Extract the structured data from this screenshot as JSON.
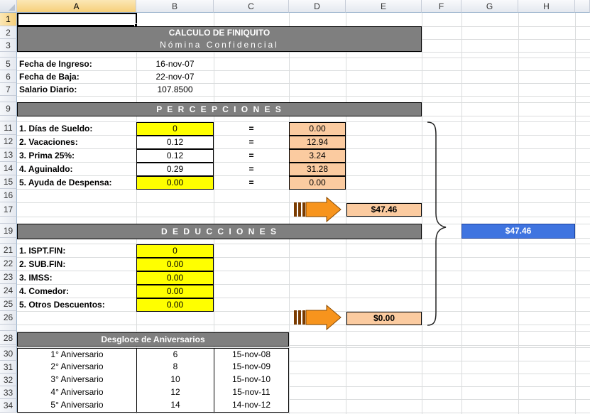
{
  "columns": [
    "A",
    "B",
    "C",
    "D",
    "E",
    "F",
    "G",
    "H"
  ],
  "rows": [
    "1",
    "2",
    "3",
    "",
    "5",
    "6",
    "7",
    "",
    "9",
    "",
    "11",
    "12",
    "13",
    "14",
    "15",
    "16",
    "17",
    "",
    "19",
    "",
    "21",
    "22",
    "23",
    "24",
    "25",
    "26",
    "",
    "28",
    "",
    "30",
    "31",
    "32",
    "33",
    "34"
  ],
  "title": {
    "main": "CALCULO DE FINIQUITO",
    "sub": "Nómina Confidencial"
  },
  "info": [
    {
      "label": "Fecha de Ingreso:",
      "value": "16-nov-07"
    },
    {
      "label": "Fecha de Baja:",
      "value": "22-nov-07"
    },
    {
      "label": "Salario Diario:",
      "value": "107.8500"
    }
  ],
  "percepciones": {
    "header": "P E R C E P C I O N E S",
    "items": [
      {
        "label": "1. Días de Sueldo:",
        "input": "0",
        "eq": "=",
        "result": "0.00"
      },
      {
        "label": "2. Vacaciones:",
        "input": "0.12",
        "eq": "=",
        "result": "12.94"
      },
      {
        "label": "3. Prima 25%:",
        "input": "0.12",
        "eq": "=",
        "result": "3.24"
      },
      {
        "label": "4. Aguinaldo:",
        "input": "0.29",
        "eq": "=",
        "result": "31.28"
      },
      {
        "label": "5. Ayuda de Despensa:",
        "input": "0.00",
        "eq": "=",
        "result": "0.00"
      }
    ],
    "total": "$47.46"
  },
  "deducciones": {
    "header": "D E D U C C I O N E S",
    "items": [
      {
        "label": "1. ISPT.FIN:",
        "input": "0"
      },
      {
        "label": "2. SUB.FIN:",
        "input": "0.00"
      },
      {
        "label": "3. IMSS:",
        "input": "0.00"
      },
      {
        "label": "4. Comedor:",
        "input": "0.00"
      },
      {
        "label": "5. Otros Descuentos:",
        "input": "0.00"
      }
    ],
    "total": "$0.00"
  },
  "neto": "$47.46",
  "aniversarios": {
    "header": "Desgloce de Aniversarios",
    "rows": [
      {
        "n": "1° Aniversario",
        "dias": "6",
        "fecha": "15-nov-08"
      },
      {
        "n": "2° Aniversario",
        "dias": "8",
        "fecha": "15-nov-09"
      },
      {
        "n": "3° Aniversario",
        "dias": "10",
        "fecha": "15-nov-10"
      },
      {
        "n": "4° Aniversario",
        "dias": "12",
        "fecha": "15-nov-11"
      },
      {
        "n": "5° Aniversario",
        "dias": "14",
        "fecha": "14-nov-12"
      }
    ]
  },
  "colors": {
    "band": "#7f7f7f",
    "input": "#ffff00",
    "result": "#fbcba0",
    "neto": "#3f74e0",
    "arrow": "#f7941d"
  }
}
